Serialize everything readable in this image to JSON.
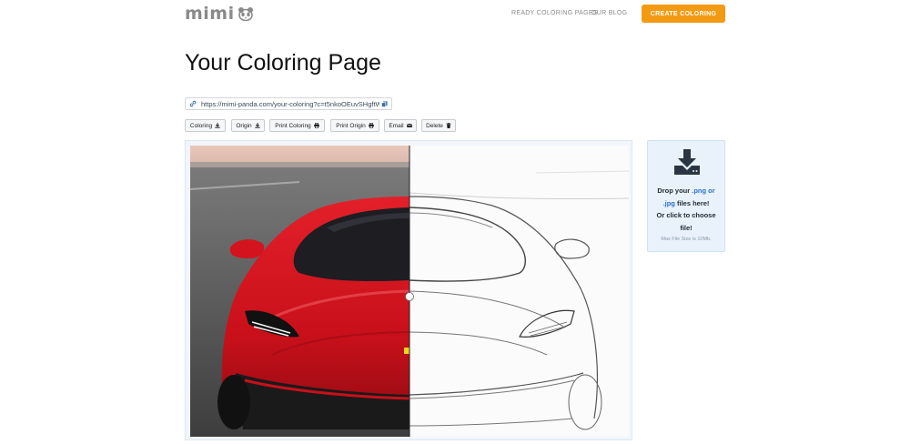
{
  "brand": {
    "name": "mimi"
  },
  "nav": {
    "links": [
      "READY COLORING PAGES",
      "OUR BLOG"
    ],
    "cta": "CREATE COLORING"
  },
  "page": {
    "title": "Your Coloring Page"
  },
  "share": {
    "url": "https://mimi-panda.com/your-coloring?c=t5nkoOEuvSHgftWa"
  },
  "toolbar": {
    "buttons": [
      {
        "label": "Coloring",
        "icon": "download-icon"
      },
      {
        "label": "Origin",
        "icon": "download-icon"
      },
      {
        "label": "Print Coloring",
        "icon": "print-icon"
      },
      {
        "label": "Print Origin",
        "icon": "print-icon"
      },
      {
        "label": "Email",
        "icon": "envelope-icon"
      },
      {
        "label": "Delete",
        "icon": "trash-icon"
      }
    ]
  },
  "compare": {
    "split": 0.5
  },
  "upload": {
    "line_prefix": "Drop your ",
    "png": ".png",
    "or": " or ",
    "jpg": ".jpg",
    "files_here": " files here!",
    "or_click": "Or click to choose file!",
    "max_size": "Max File Size is 10Mb."
  },
  "colors": {
    "accent": "#f39a13",
    "link": "#2a6fcf",
    "car_red": "#d8151f"
  }
}
